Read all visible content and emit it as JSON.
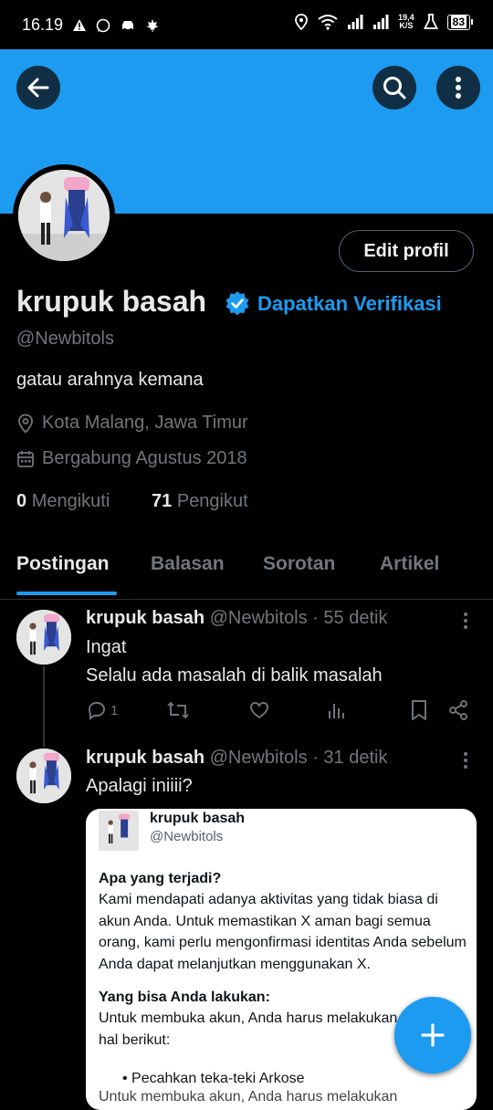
{
  "status_bar": {
    "time": "16.19",
    "speed_value": "19,4",
    "speed_unit": "K/S",
    "battery": "83"
  },
  "colors": {
    "accent": "#1d9bf0",
    "background": "#000000",
    "muted": "#71767b",
    "text": "#e7e9ea"
  },
  "profile": {
    "edit_label": "Edit profil",
    "name": "krupuk basah",
    "get_verified": "Dapatkan Verifikasi",
    "handle": "@Newbitols",
    "bio": "gatau arahnya kemana",
    "location": "Kota Malang, Jawa Timur",
    "joined": "Bergabung Agustus 2018",
    "following_count": "0",
    "following_label": "Mengikuti",
    "followers_count": "71",
    "followers_label": "Pengikut"
  },
  "tabs": [
    {
      "label": "Postingan",
      "active": true
    },
    {
      "label": "Balasan"
    },
    {
      "label": "Sorotan"
    },
    {
      "label": "Artikel"
    }
  ],
  "posts": [
    {
      "name": "krupuk basah",
      "handle": "@Newbitols",
      "time": "· 55 detik",
      "line1": "Ingat",
      "line2": "Selalu ada masalah di balik masalah",
      "reply_count": "1"
    },
    {
      "name": "krupuk basah",
      "handle": "@Newbitols",
      "time": "· 31 detik",
      "text": "Apalagi iniiii?",
      "embed": {
        "name": "krupuk basah",
        "handle": "@Newbitols",
        "heading1": "Apa yang terjadi?",
        "p1": "Kami mendapati adanya aktivitas yang tidak biasa di akun Anda. Untuk memastikan X aman bagi semua orang, kami perlu mengonfirmasi identitas Anda sebelum Anda dapat melanjutkan menggunakan X.",
        "heading2": "Yang bisa Anda lakukan:",
        "p2": "Untuk membuka akun, Anda harus melakukan hal berikut:",
        "bullet": "Pecahkan teka-teki Arkose",
        "cut_line": "Untuk membuka akun, Anda harus melakukan"
      }
    }
  ],
  "icons": [
    "back-arrow-icon",
    "search-icon",
    "more-vertical-icon",
    "verified-badge-icon",
    "location-pin-icon",
    "calendar-icon",
    "reply-icon",
    "repost-icon",
    "like-icon",
    "views-icon",
    "bookmark-icon",
    "share-icon",
    "plus-icon"
  ]
}
